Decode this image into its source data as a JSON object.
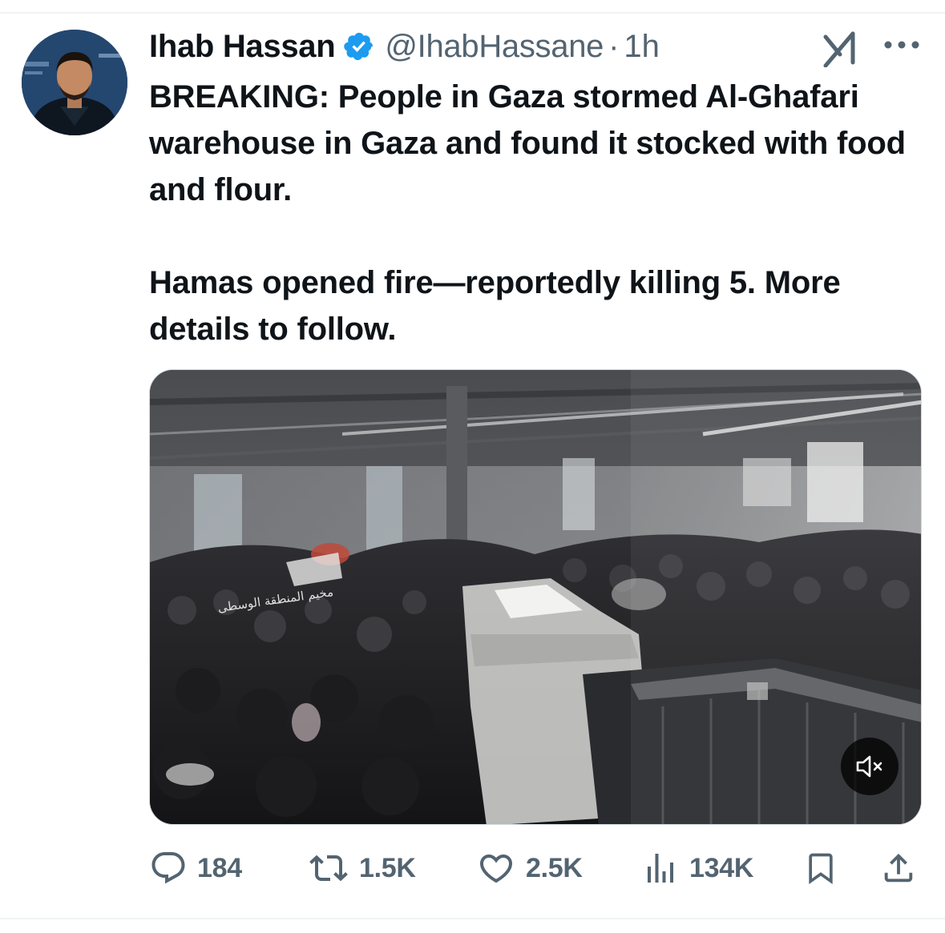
{
  "author": {
    "display_name": "Ihab Hassan",
    "handle": "@IhabHassane",
    "separator": "·",
    "time": "1h",
    "verified": true
  },
  "tweet": {
    "paragraphs": [
      "BREAKING: People in Gaza stormed Al-Ghafari warehouse in Gaza and found it stocked with food and flour.",
      "Hamas opened fire—reportedly killing 5. More details to follow."
    ]
  },
  "media": {
    "type": "video",
    "watermark": "مخيم المنطقة الوسطى",
    "muted": true
  },
  "actions": {
    "replies": "184",
    "reposts": "1.5K",
    "likes": "2.5K",
    "views": "134K"
  },
  "icons": {
    "reply": "speech-bubble-icon",
    "repost": "repost-arrows-icon",
    "like": "heart-icon",
    "views": "bar-chart-icon",
    "bookmark": "bookmark-icon",
    "share": "share-upload-icon",
    "grok": "grok-icon",
    "more": "more-dots-icon",
    "mute": "speaker-muted-icon"
  },
  "colors": {
    "text_primary": "#0f1419",
    "text_secondary": "#536471",
    "verified_blue": "#1d9bf0",
    "divider": "#eff3f4"
  }
}
